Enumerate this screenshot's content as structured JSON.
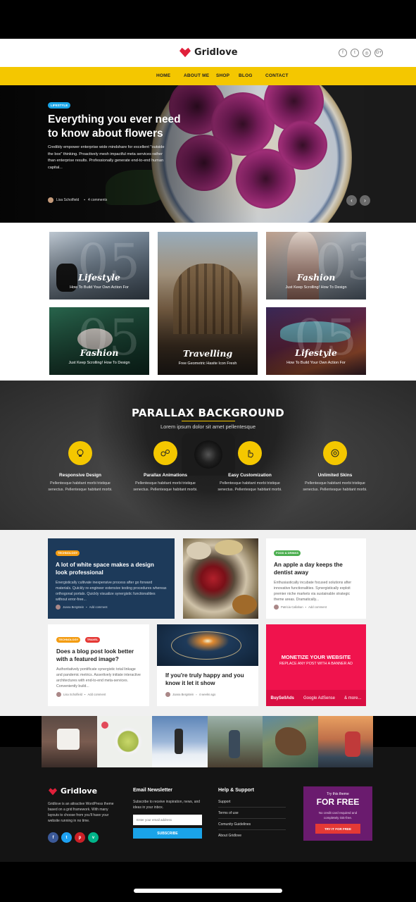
{
  "brand": {
    "name": "Gridlove",
    "accent": "#f4c700",
    "heart_color": "#e0203a"
  },
  "header": {
    "socials": [
      {
        "icon": "facebook-icon",
        "glyph": "f"
      },
      {
        "icon": "twitter-icon",
        "glyph": "t"
      },
      {
        "icon": "instagram-icon",
        "glyph": "◎"
      },
      {
        "icon": "google-plus-icon",
        "glyph": "G+"
      }
    ]
  },
  "nav": {
    "items": [
      "HOME",
      "ABOUT ME",
      "SHOP",
      "BLOG",
      "CONTACT"
    ]
  },
  "hero": {
    "badge": "LIFESTYLE",
    "title": "Everything you ever need to know about flowers",
    "text": "Credibly empower enterprise wide mindshare for excellent \"outside the box\" thinking. Proactively mesh impactful meta services rather than enterprise results. Professionally generate end-to-end human capital...",
    "author": "Lisa Scholfield",
    "comments": "4 comments",
    "prev": "‹",
    "next": "›"
  },
  "tiles": [
    {
      "title": "Lifestyle",
      "sub": "How To Build Your Own Action For",
      "num": "05"
    },
    {
      "title": "Travelling",
      "sub": "Free Geometric Hasite Icon Fresh",
      "num": ""
    },
    {
      "title": "Fashion",
      "sub": "Just Keep Scrolling! How To Design",
      "num": "03"
    },
    {
      "title": "Fashion",
      "sub": "Just Keep Scrolling! How To Design",
      "num": "05"
    },
    {
      "title": "Lifestyle",
      "sub": "How To Build Your Own Action For",
      "num": "05"
    }
  ],
  "parallax": {
    "title": "PARALLAX BACKGROUND",
    "subtitle": "Lorem ipsum dolor sit amet pellentesque",
    "features": [
      {
        "icon": "lightbulb-icon",
        "title": "Responsive Design",
        "text": "Pellentesque habitant morbi tristique senectus. Pellentesque habitant morbi."
      },
      {
        "icon": "gears-icon",
        "title": "Parallax Animations",
        "text": "Pellentesque habitant morbi tristique senectus. Pellentesque habitant morbi."
      },
      {
        "icon": "hand-pointer-icon",
        "title": "Easy Customization",
        "text": "Pellentesque habitant morbi tristique senectus. Pellentesque habitant morbi."
      },
      {
        "icon": "palette-icon",
        "title": "Unlimited Skins",
        "text": "Pellentesque habitant morbi tristique senectus. Pellentesque habitant morbi."
      }
    ]
  },
  "posts": {
    "p1": {
      "badge": "TECHNOLOGY",
      "title": "A lot of white space makes a design look professional",
      "text": "Energistically cultivate inexpensive process after go forward materials. Quickly re-engineer extensive testing procedures whereas orthogonal portals. Quickly visualize synergistic functionalities without error-free...",
      "author": "Joana Bergstein",
      "comments": "Add comment"
    },
    "p2": {
      "badge": "FOOD & DRINKS",
      "title": "An apple a day keeps the dentist away",
      "text": "Enthusiastically incubate focused solutions after innovative functionalities. Synergistically exploit premier niche markets via sustainable strategic theme areas. Dramatically...",
      "author": "Patricia Callahan",
      "comments": "Add comment"
    },
    "p3": {
      "badges": [
        "TECHNOLOGY",
        "TRAVEL"
      ],
      "title": "Does a blog post look better with a featured image?",
      "text": "Authoritatively pontificate synergistic total linkage and pandemic metrics. Assertively initiate interactive architectures with end-to-end meta-services. Conveniently build...",
      "author": "Lisa Scholfield",
      "comments": "Add comment"
    },
    "p4": {
      "title": "If you're truly happy and you know it let it show",
      "author": "Joana Bergstein",
      "date": "4 weeks ago"
    },
    "ad": {
      "title": "MONETIZE YOUR WEBSITE",
      "sub": "REPLACE ANY POST WITH A BANNER AD",
      "links": [
        "BuySellAds",
        "Google AdSense",
        "& more..."
      ]
    }
  },
  "footer": {
    "about": "Gridlove is an attractive WordPress theme based on a grid framework. With many layouts to choose from you'll have your website running in no time.",
    "newsletter": {
      "title": "Email Newsletter",
      "text": "Subscribe to receive inspiration, news, and ideas in your inbox.",
      "placeholder": "Enter your email address",
      "button": "SUBSCRIBE"
    },
    "support": {
      "title": "Help & Support",
      "links": [
        "Support",
        "Terms of use",
        "Comunity Guidelines",
        "About Gridlove"
      ]
    },
    "promo": {
      "small": "Try this theme",
      "big": "FOR FREE",
      "text": "No credit card required and completely risk-free.",
      "button": "TRY IT FOR FREE"
    },
    "socials": [
      {
        "icon": "facebook-icon",
        "glyph": "f",
        "color": "#3b5998"
      },
      {
        "icon": "twitter-icon",
        "glyph": "t",
        "color": "#1da1f2"
      },
      {
        "icon": "pinterest-icon",
        "glyph": "p",
        "color": "#cb2027"
      },
      {
        "icon": "vine-icon",
        "glyph": "v",
        "color": "#00b489"
      }
    ]
  }
}
